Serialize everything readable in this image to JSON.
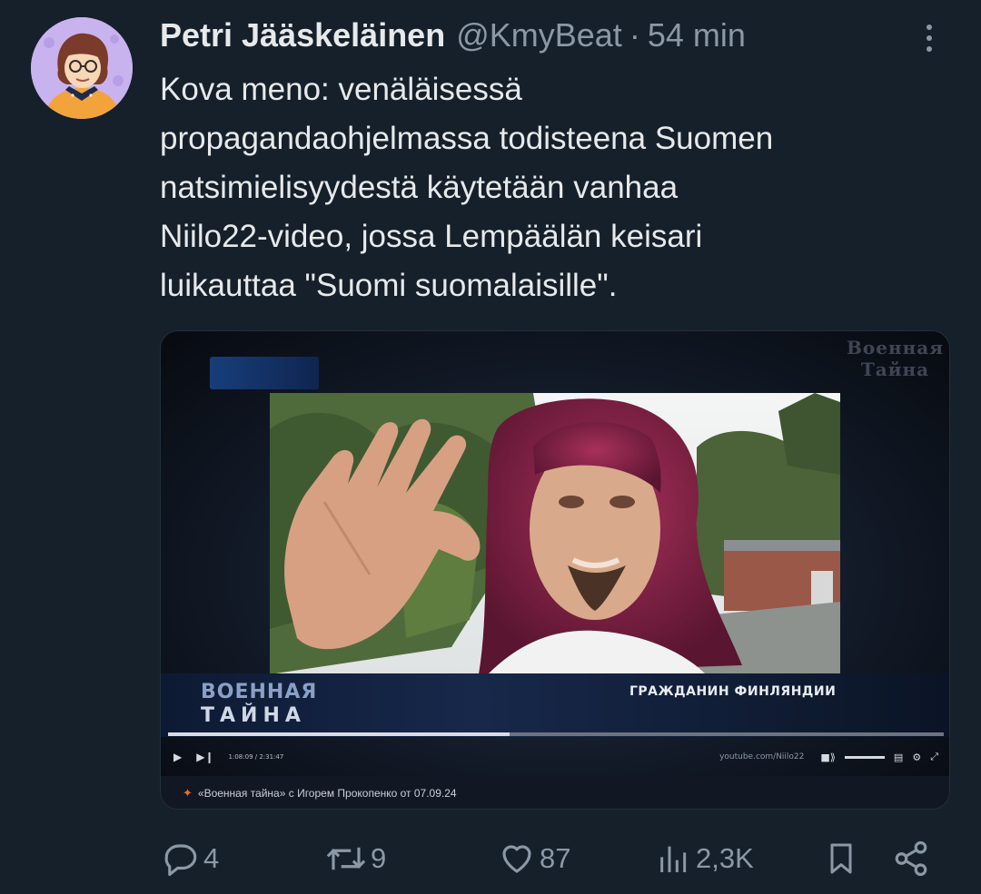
{
  "tweet": {
    "author_name": "Petri Jääskeläinen",
    "handle": "@KmyBeat",
    "separator": "·",
    "time": "54 min",
    "text_lines": [
      "Kova meno: venäläisessä",
      "propagandaohjelmassa todisteena Suomen",
      "natsimielisyydestä käytetään vanhaa",
      "Niilo22-video, jossa Lempäälän keisari",
      "luikauttaa \"Suomi suomalaisille\"."
    ]
  },
  "media": {
    "watermark_line1": "Военная",
    "watermark_line2": "Тайна",
    "show_title_line1": "ВОЕННАЯ",
    "show_title_line2": "ТАЙНА",
    "caption": "ГРАЖДАНИН ФИНЛЯНДИИ",
    "player_time": "1:08:09 / 2:31:47",
    "youtube_credit": "youtube.com/Niilo22",
    "progress": 0.44,
    "source": "«Военная тайна» с Игорем Прокопенко от 07.09.24"
  },
  "actions": {
    "replies": "4",
    "reposts": "9",
    "likes": "87",
    "views": "2,3K"
  },
  "icons": {
    "reply": "reply-icon",
    "repost": "repost-icon",
    "like": "heart-icon",
    "views": "views-icon",
    "bookmark": "bookmark-icon",
    "share": "share-icon",
    "more": "more-icon"
  },
  "colors": {
    "background": "#15202b",
    "text": "#e7e9ea",
    "secondary": "#8b98a5"
  }
}
